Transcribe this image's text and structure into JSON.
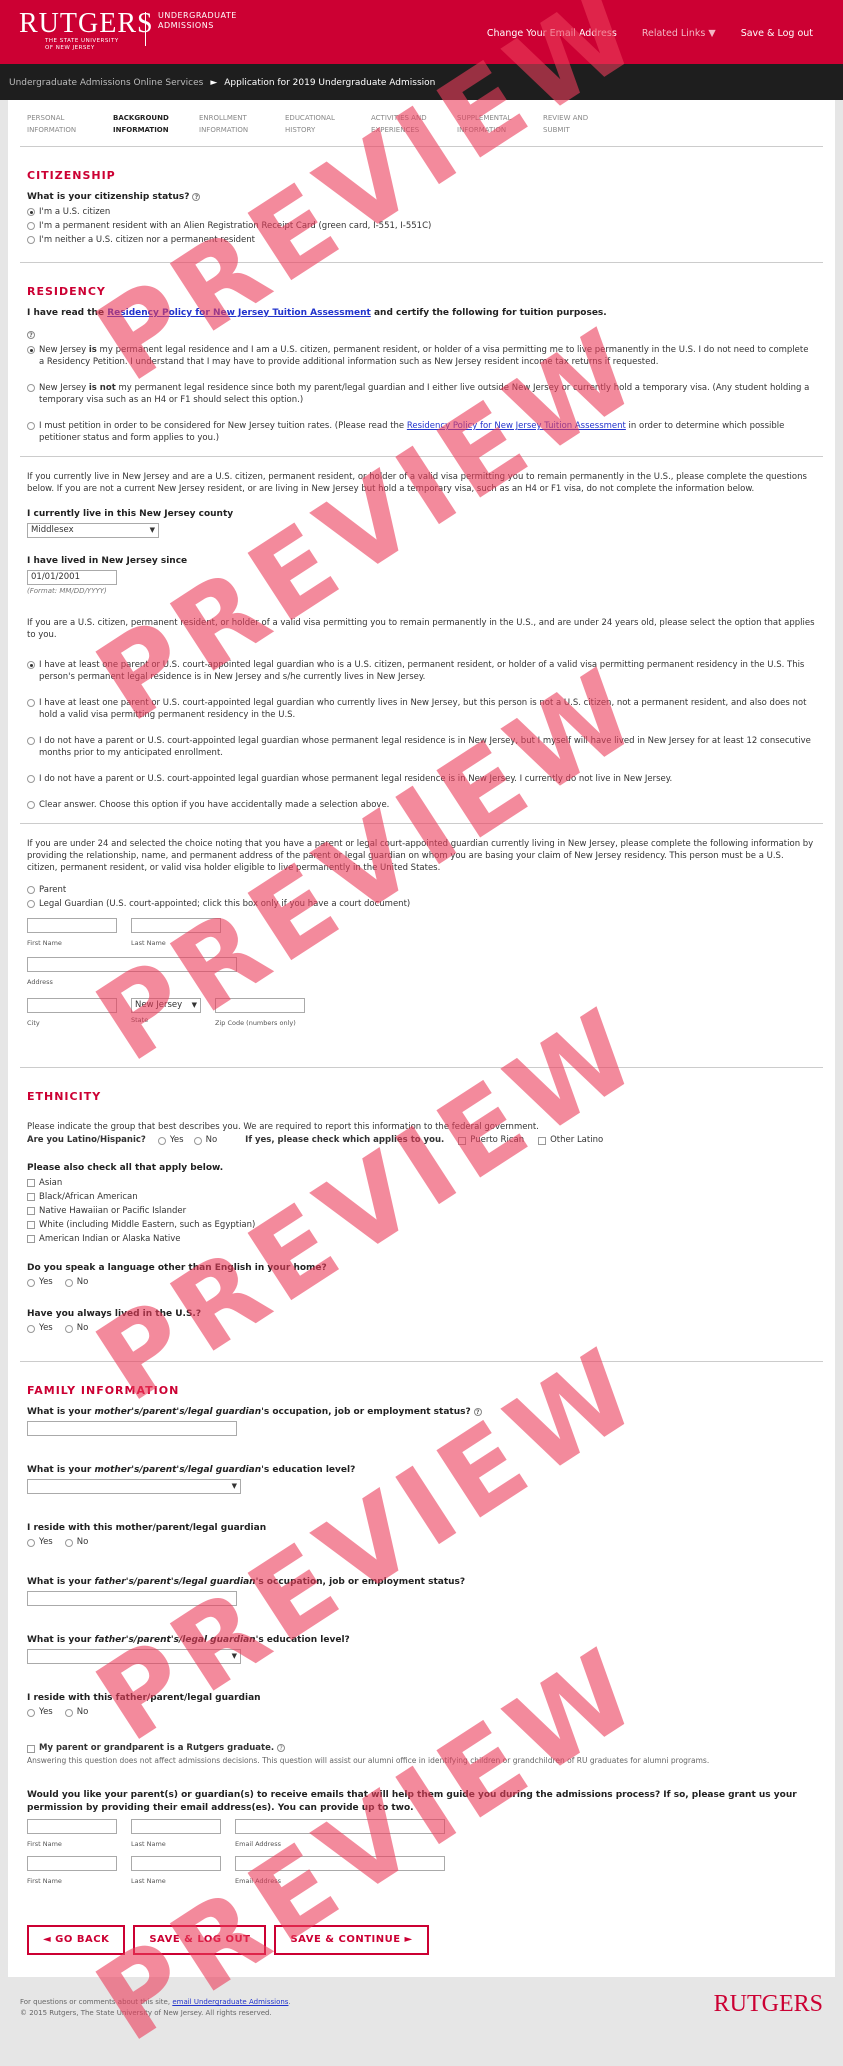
{
  "header": {
    "logo": "RUTGERS",
    "logo_sub1": "THE STATE UNIVERSITY",
    "logo_sub2": "OF NEW JERSEY",
    "unit1": "UNDERGRADUATE",
    "unit2": "ADMISSIONS",
    "nav": [
      "Change Your Email Address",
      "Related Links ▼",
      "Save & Log out"
    ]
  },
  "crumbs": {
    "c1": "Undergraduate Admissions Online Services",
    "arrow": "►",
    "c2": "Application for 2019 Undergraduate Admission"
  },
  "steps": [
    {
      "l1": "PERSONAL",
      "l2": "INFORMATION"
    },
    {
      "l1": "BACKGROUND",
      "l2": "INFORMATION"
    },
    {
      "l1": "ENROLLMENT",
      "l2": "INFORMATION"
    },
    {
      "l1": "EDUCATIONAL",
      "l2": "HISTORY"
    },
    {
      "l1": "ACTIVITIES AND",
      "l2": "EXPERIENCES"
    },
    {
      "l1": "SUPPLEMENTAL",
      "l2": "INFORMATION"
    },
    {
      "l1": "REVIEW AND",
      "l2": "SUBMIT"
    }
  ],
  "citizenship": {
    "title": "CITIZENSHIP",
    "q": "What is your citizenship status?",
    "opts": [
      "I'm a U.S. citizen",
      "I'm a permanent resident with an Alien Registration Receipt Card (green card, I-551, I-551C)",
      "I'm neither a U.S. citizen nor a permanent resident"
    ]
  },
  "residency": {
    "title": "RESIDENCY",
    "intro_a": "I have read the ",
    "intro_link": "Residency Policy for New Jersey Tuition Assessment",
    "intro_b": " and certify the following for tuition purposes.",
    "o1_a": "New Jersey ",
    "o1_is": "is",
    "o1_b": " my permanent legal residence and I am a U.S. citizen, permanent resident, or holder of a visa permitting me to live permanently in the U.S. I do not need to complete a Residency Petition. I understand that I may have to provide additional information such as New Jersey resident income tax returns if requested.",
    "o2_a": "New Jersey ",
    "o2_is": "is not",
    "o2_b": " my permanent legal residence since both my parent/legal guardian and I either live outside New Jersey or currently hold a temporary visa. (Any student holding a temporary visa such as an H4 or F1 should select this option.)",
    "o3_a": "I must petition in order to be considered for New Jersey tuition rates. (Please read the ",
    "o3_link": "Residency Policy for New Jersey Tuition Assessment",
    "o3_b": " in order to determine which possible petitioner status and form applies to you.)",
    "curr": "If you currently live in New Jersey and are a U.S. citizen, permanent resident, or holder of a valid visa permitting you to remain permanently in the U.S., please complete the questions below. If you are not a current New Jersey resident, or are living in New Jersey but hold a temporary visa, such as an H4 or F1 visa, do not complete the information below.",
    "county_q": "I currently live in this New Jersey county",
    "county": "Middlesex",
    "since_q": "I have lived in New Jersey since",
    "since": "01/01/2001",
    "fmt": "(Format: MM/DD/YYYY)",
    "under24": "If you are a U.S. citizen, permanent resident, or holder of a valid visa permitting you to remain permanently in the U.S., and are under 24 years old, please select the option that applies to you.",
    "p1": "I have at least one parent or U.S. court-appointed legal guardian who is a U.S. citizen, permanent resident, or holder of a valid visa permitting permanent residency in the U.S. This person's permanent legal residence is in New Jersey and s/he currently lives in New Jersey.",
    "p2": "I have at least one parent or U.S. court-appointed legal guardian who currently lives in New Jersey, but this person is not a U.S. citizen, not a permanent resident, and also does not hold a valid visa permitting permanent residency in the U.S.",
    "p3": "I do not have a parent or U.S. court-appointed legal guardian whose permanent legal residence is in New Jersey, but I myself will have lived in New Jersey for at least 12 consecutive months prior to my anticipated enrollment.",
    "p4": "I do not have a parent or U.S. court-appointed legal guardian whose permanent legal residence is in New Jersey. I currently do not live in New Jersey.",
    "p5": "Clear answer. Choose this option if you have accidentally made a selection above.",
    "guard": "If you are under 24 and selected the choice noting that you have a parent or legal court-appointed guardian currently living in New Jersey, please complete the following information by providing the relationship, name, and permanent address of the parent or legal guardian on whom you are basing your claim of New Jersey residency. This person must be a U.S. citizen, permanent resident, or valid visa holder eligible to live permanently in the United States.",
    "parent": "Parent",
    "legal": "Legal Guardian (U.S. court-appointed; click this box only if you have a court document)",
    "first": "First Name",
    "last": "Last Name",
    "address": "Address",
    "city": "City",
    "state_l": "State",
    "state": "New Jersey",
    "zip": "Zip Code (numbers only)"
  },
  "ethnicity": {
    "title": "ETHNICITY",
    "intro": "Please indicate the group that best describes you. We are required to report this information to the federal government.",
    "latino_q": "Are you Latino/Hispanic?",
    "yes": "Yes",
    "no": "No",
    "ifyes": "If yes, please check which applies to you.",
    "pr": "Puerto Rican",
    "ol": "Other Latino",
    "also": "Please also check all that apply below.",
    "races": [
      "Asian",
      "Black/African American",
      "Native Hawaiian or Pacific Islander",
      "White (including Middle Eastern, such as Egyptian)",
      "American Indian or Alaska Native"
    ],
    "lang_q": "Do you speak a language other than English in your home?",
    "us_q": "Have you always lived in the U.S.?"
  },
  "family": {
    "title": "FAMILY INFORMATION",
    "m_occ_a": "What is your ",
    "m_occ_i": "mother's/parent's/legal guardian",
    "m_occ_b": "'s occupation, job or employment status?",
    "m_edu_b": "'s education level?",
    "m_res": "I reside with this mother/parent/legal guardian",
    "f_i": "father's/parent's/legal guardian",
    "f_res": "I reside with this father/parent/legal guardian",
    "grad": "My parent or grandparent is a Rutgers graduate.",
    "grad_note": "Answering this question does not affect admissions decisions. This question will assist our alumni office in identifying children or grandchildren of RU graduates for alumni programs.",
    "emails_q": "Would you like your parent(s) or guardian(s) to receive emails that will help them guide you during the admissions process? If so, please grant us your permission by providing their email address(es). You can provide up to two.",
    "email": "Email Address"
  },
  "buttons": {
    "back": "◄ GO BACK",
    "save": "SAVE & LOG OUT",
    "cont": "SAVE & CONTINUE ►"
  },
  "footer": {
    "l1a": "For questions or comments about this site, ",
    "l1link": "email Undergraduate Admissions",
    "l1b": ".",
    "l2": "© 2015 Rutgers, The State University of New Jersey. All rights reserved.",
    "logo": "RUTGERS"
  },
  "watermark": "PREVIEW"
}
